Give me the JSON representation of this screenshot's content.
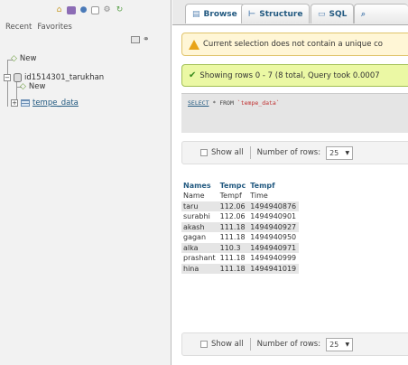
{
  "nav": {
    "tabs": [
      "Recent",
      "Favorites"
    ],
    "tree": {
      "root_new": "New",
      "database": "id1514301_tarukhan",
      "db_new": "New",
      "table": "tempe_data"
    }
  },
  "main": {
    "tabs": [
      {
        "label": "Browse",
        "icon": "browse-icon"
      },
      {
        "label": "Structure",
        "icon": "structure-icon"
      },
      {
        "label": "SQL",
        "icon": "sql-icon"
      }
    ],
    "notice": "Current selection does not contain a unique co",
    "success": "Showing rows 0 - 7 (8 total, Query took 0.0007",
    "sql": {
      "select": "SELECT",
      "rest": " * FROM ",
      "table": "`tempe_data`"
    },
    "navrow": {
      "show_all": "Show all",
      "rows_label": "Number of rows:",
      "rows_value": "25"
    },
    "table": {
      "columns": [
        "Names",
        "Tempc",
        "Tempf"
      ],
      "rows": [
        [
          "Name",
          "Tempf",
          "Time"
        ],
        [
          "taru",
          "112.06",
          "1494940876"
        ],
        [
          "surabhi",
          "112.06",
          "1494940901"
        ],
        [
          "akash",
          "111.18",
          "1494940927"
        ],
        [
          "gagan",
          "111.18",
          "1494940950"
        ],
        [
          "alka",
          "110.3",
          "1494940971"
        ],
        [
          "prashant",
          "111.18",
          "1494940999"
        ],
        [
          "hina",
          "111.18",
          "1494941019"
        ]
      ]
    }
  },
  "colors": {
    "link": "#235a81",
    "notice_bg": "#fff6d6",
    "success_bg": "#ebf8a4",
    "row_even": "#e5e5e5"
  }
}
